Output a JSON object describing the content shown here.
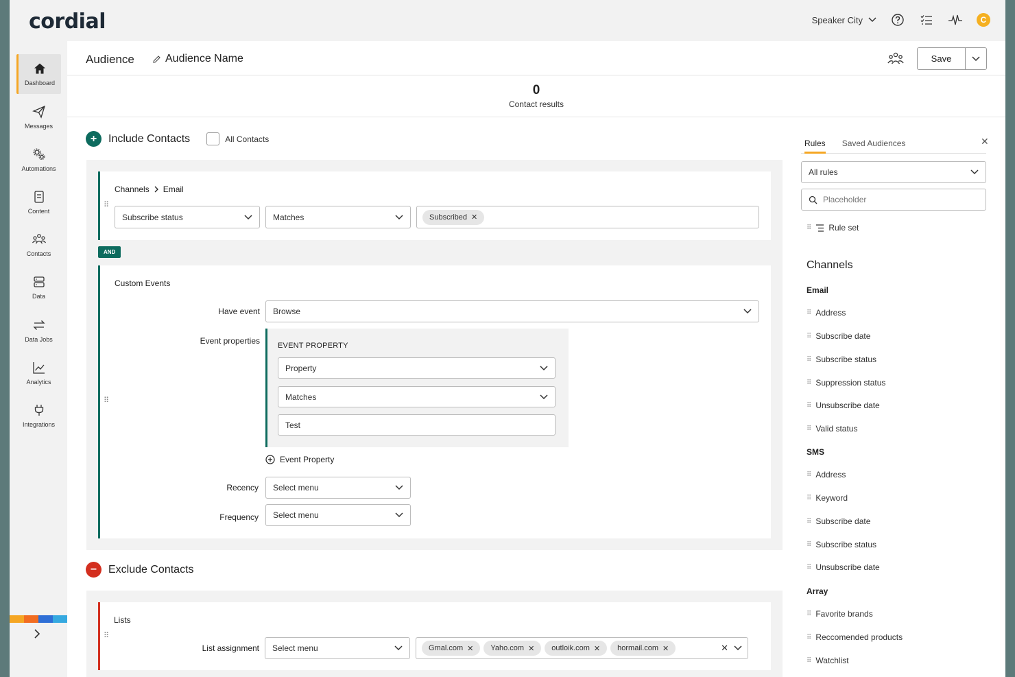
{
  "app": {
    "logo": "cordial",
    "account": "Speaker City",
    "avatar_initial": "C"
  },
  "nav": [
    {
      "label": "Dashboard",
      "icon": "home-icon",
      "active": true
    },
    {
      "label": "Messages",
      "icon": "send-icon"
    },
    {
      "label": "Automations",
      "icon": "gears-icon"
    },
    {
      "label": "Content",
      "icon": "content-icon"
    },
    {
      "label": "Contacts",
      "icon": "contacts-icon"
    },
    {
      "label": "Data",
      "icon": "database-icon"
    },
    {
      "label": "Data Jobs",
      "icon": "transfer-icon"
    },
    {
      "label": "Analytics",
      "icon": "analytics-icon"
    },
    {
      "label": "Integrations",
      "icon": "plug-icon"
    }
  ],
  "header": {
    "section": "Audience",
    "name": "Audience Name",
    "save_label": "Save"
  },
  "results": {
    "count": "0",
    "caption": "Contact results"
  },
  "include": {
    "title": "Include Contacts",
    "all_contacts_label": "All Contacts",
    "channels_card": {
      "crumb_parent": "Channels",
      "crumb_child": "Email",
      "field": "Subscribe status",
      "operator": "Matches",
      "values": [
        "Subscribed"
      ]
    },
    "and_label": "AND",
    "events_card": {
      "title": "Custom Events",
      "have_event_label": "Have event",
      "have_event_value": "Browse",
      "event_properties_label": "Event properties",
      "event_property_heading": "EVENT PROPERTY",
      "property_select": "Property",
      "matches_select": "Matches",
      "test_value": "Test",
      "add_property_label": "Event Property",
      "recency_label": "Recency",
      "recency_value": "Select menu",
      "frequency_label": "Frequency",
      "frequency_value": "Select menu"
    }
  },
  "exclude": {
    "title": "Exclude Contacts",
    "lists_card": {
      "title": "Lists",
      "assignment_label": "List assignment",
      "assignment_value": "Select menu",
      "values": [
        "Gmal.com",
        "Yaho.com",
        "outloik.com",
        "hormail.com"
      ]
    }
  },
  "rules_panel": {
    "tabs": [
      "Rules",
      "Saved Audiences"
    ],
    "filter_value": "All rules",
    "search_placeholder": "Placeholder",
    "rule_set_label": "Rule set",
    "channels_heading": "Channels",
    "groups": [
      {
        "name": "Email",
        "items": [
          "Address",
          "Subscribe date",
          "Subscribe status",
          "Suppression status",
          "Unsubscribe date",
          "Valid status"
        ]
      },
      {
        "name": "SMS",
        "items": [
          "Address",
          "Keyword",
          "Subscribe date",
          "Subscribe status",
          "Unsubscribe date"
        ]
      },
      {
        "name": "Array",
        "items": [
          "Favorite brands",
          "Reccomended products",
          "Watchlist"
        ]
      }
    ]
  },
  "colors": {
    "accent": "#f5a623",
    "teal": "#0d6b5e",
    "red": "#d32f1f",
    "brand_stripes": [
      "#f5a623",
      "#f26d21",
      "#2f6fd6",
      "#36a9e0"
    ]
  }
}
